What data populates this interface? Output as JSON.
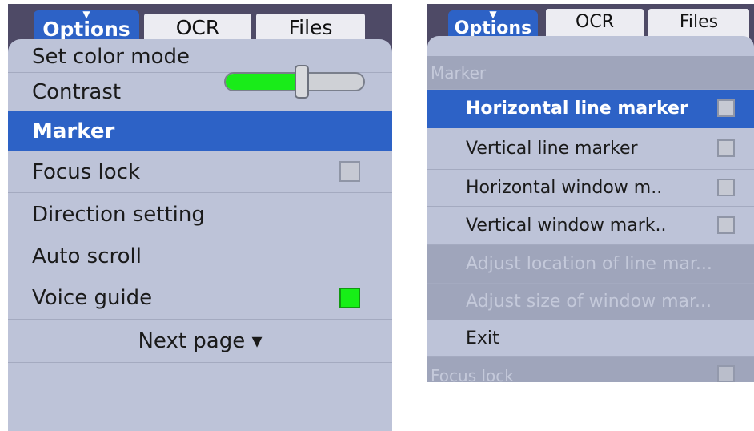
{
  "left": {
    "tabs": {
      "active": "Options",
      "ocr": "OCR",
      "files": "Files"
    },
    "items": {
      "set_color_mode": "Set color mode",
      "contrast": "Contrast",
      "marker": "Marker",
      "focus_lock": "Focus lock",
      "direction_setting": "Direction setting",
      "auto_scroll": "Auto scroll",
      "voice_guide": "Voice guide",
      "next_page": "Next page ▾"
    },
    "contrast_level": 0.55,
    "focus_lock_checked": false,
    "voice_guide_checked": true
  },
  "right": {
    "tabs": {
      "active": "Options",
      "ocr": "OCR",
      "files": "Files"
    },
    "header": "Marker",
    "items": {
      "horizontal_line_marker": "Horizontal line marker",
      "vertical_line_marker": "Vertical line marker",
      "horizontal_window_marker": "Horizontal window m..",
      "vertical_window_marker": "Vertical window mark..",
      "adjust_line_location": "Adjust location of line mar...",
      "adjust_window_size": "Adjust size of window mar...",
      "exit": "Exit",
      "focus_lock": "Focus lock"
    }
  },
  "colors": {
    "selection": "#2d62c6",
    "menu_bg": "#bdc3d8",
    "frame": "#4e4a66",
    "checked": "#17ef17"
  },
  "icons": {
    "caret": "caret-down-icon"
  }
}
